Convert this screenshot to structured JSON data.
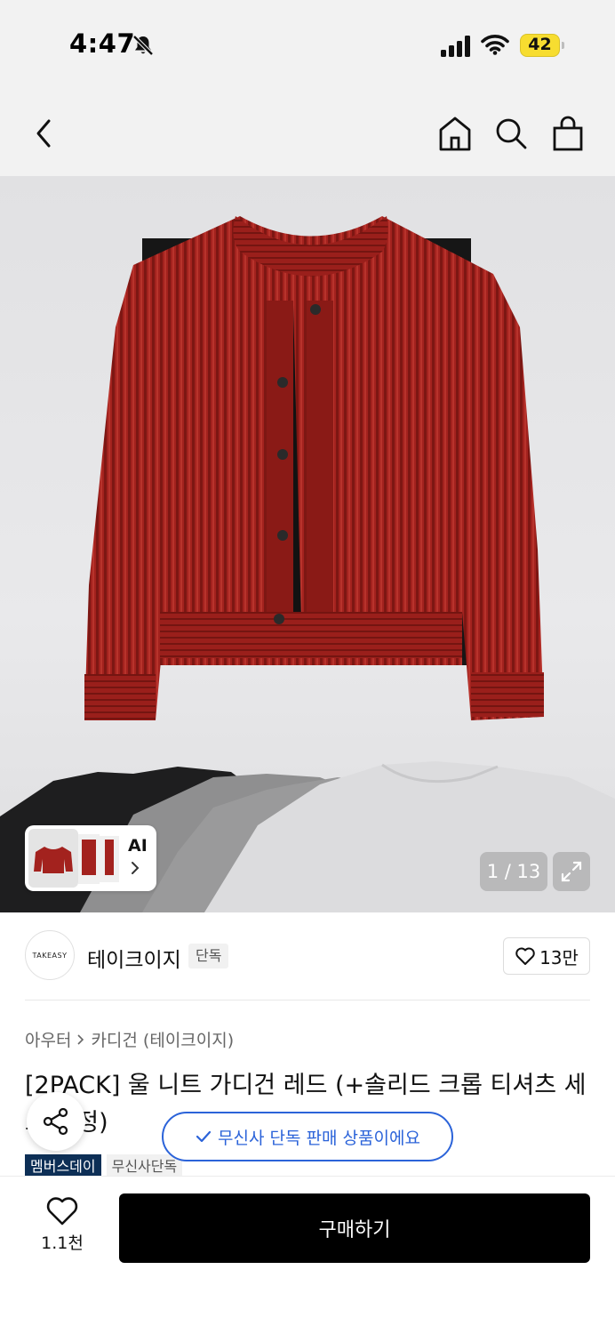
{
  "status_bar": {
    "time": "4:47",
    "battery": "42",
    "icons": [
      "bell-slash-icon",
      "cellular-signal-icon",
      "wifi-icon",
      "battery-icon"
    ]
  },
  "nav": {
    "icons": [
      "back-chevron-icon",
      "home-icon",
      "search-icon",
      "shopping-bag-icon"
    ]
  },
  "gallery": {
    "ai_label": "AI",
    "page_counter": "1 / 13",
    "icons": [
      "chevron-right-icon",
      "expand-icon"
    ]
  },
  "brand": {
    "logo_text": "TAKEASY",
    "name": "테이크이지",
    "tag": "단독",
    "like_count": "13만"
  },
  "product": {
    "breadcrumb": [
      "아우터",
      "카디건 (테이크이지)"
    ],
    "title": "[2PACK] 울 니트 가디건 레드 (+솔리드 크롭 티셔츠 세트 고정)",
    "badges": [
      "멤버스데이",
      "무신사단독"
    ]
  },
  "toast": {
    "text": "무신사 단독 판매 상품이에요"
  },
  "bottom_bar": {
    "wish_count": "1.1천",
    "buy_label": "구매하기"
  },
  "colors": {
    "accent_blue": "#2b63d9",
    "member_badge": "#0d2f56",
    "battery": "#f7dd30",
    "cardigan_red": "#a3221e"
  }
}
